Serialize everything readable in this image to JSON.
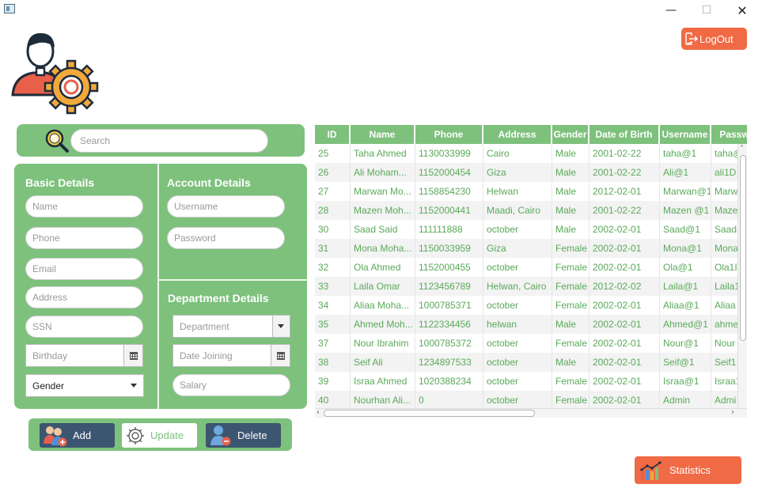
{
  "window": {
    "minimize_glyph": "—",
    "maximize_glyph": "☐",
    "close_glyph": "✕"
  },
  "header": {
    "logout_label": "LogOut"
  },
  "search": {
    "placeholder": "Search"
  },
  "basic": {
    "title": "Basic Details",
    "name_placeholder": "Name",
    "phone_placeholder": "Phone",
    "email_placeholder": "Email",
    "address_placeholder": "Address",
    "ssn_placeholder": "SSN",
    "birthday_placeholder": "Birthday",
    "gender_value": "Gender"
  },
  "account": {
    "title": "Account Details",
    "username_placeholder": "Username",
    "password_placeholder": "Password"
  },
  "department": {
    "title": "Department Details",
    "department_value": "Department",
    "date_joining_placeholder": "Date Joining",
    "salary_placeholder": "Salary"
  },
  "actions": {
    "add": "Add",
    "update": "Update",
    "delete": "Delete"
  },
  "stats": {
    "label": "Statistics"
  },
  "colors": {
    "green": "#7dc17c",
    "orange": "#f06a45",
    "navy": "#3c5570"
  },
  "table": {
    "columns": [
      "ID",
      "Name",
      "Phone",
      "Address",
      "Gender",
      "Date of Birth",
      "Username",
      "Passw"
    ],
    "rows": [
      [
        "25",
        "Taha Ahmed",
        "1130033999",
        "Cairo",
        "Male",
        "2001-02-22",
        "taha@1",
        "taha@"
      ],
      [
        "26",
        "Ali Moham...",
        "1152000454",
        "Giza",
        "Male",
        "2001-02-22",
        "Ali@1",
        "ali1D"
      ],
      [
        "27",
        "Marwan Mo...",
        "1158854230",
        "Helwan",
        "Male",
        "2012-02-01",
        "Marwan@1",
        "Marw"
      ],
      [
        "28",
        "Mazen Moh...",
        "1152000441",
        "Maadi, Cairo",
        "Male",
        "2001-02-22",
        "Mazen @1",
        "Maze"
      ],
      [
        "30",
        "Saad Said",
        "111111888",
        "october",
        "Male",
        "2002-02-01",
        "Saad@1",
        "Saad"
      ],
      [
        "31",
        "Mona Moha...",
        "1150033959",
        "Giza",
        "Female",
        "2002-02-01",
        "Mona@1",
        "Mona"
      ],
      [
        "32",
        "Ola Ahmed",
        "1152000455",
        "october",
        "Female",
        "2002-02-01",
        "Ola@1",
        "Ola1I"
      ],
      [
        "33",
        "Laila Omar",
        "1123456789",
        "Helwan, Cairo",
        "Female",
        "2012-02-02",
        "Laila@1",
        "Laila1"
      ],
      [
        "34",
        "Aliaa Moha...",
        "1000785371",
        "october",
        "Female",
        "2002-02-01",
        "Aliaa@1",
        "Aliaa"
      ],
      [
        "35",
        "Ahmed Moh...",
        "1122334456",
        "helwan",
        "Male",
        "2002-02-01",
        "Ahmed@1",
        "ahme"
      ],
      [
        "37",
        "Nour Ibrahim",
        "1000785372",
        "october",
        "Female",
        "2002-02-01",
        "Nour@1",
        "Nour"
      ],
      [
        "38",
        "Seif Ali",
        "1234897533",
        "october",
        "Male",
        "2002-02-01",
        "Seif@1",
        "Seif1"
      ],
      [
        "39",
        "Israa Ahmed",
        "1020388234",
        "october",
        "Female",
        "2002-02-01",
        "Israa@1",
        "Israa1"
      ],
      [
        "40",
        "Nourhan Ali...",
        "0",
        "october",
        "Female",
        "2002-02-01",
        "Admin",
        "Admi"
      ]
    ]
  }
}
